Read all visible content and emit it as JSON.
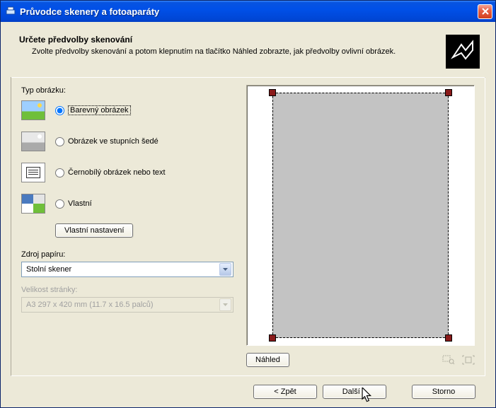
{
  "titlebar": {
    "title": "Průvodce skenery a fotoaparáty"
  },
  "header": {
    "title": "Určete předvolby skenování",
    "desc": "Zvolte předvolby skenování a potom klepnutím na tlačítko Náhled zobrazte, jak předvolby ovlivní obrázek."
  },
  "labels": {
    "picture_type": "Typ obrázku:",
    "paper_source": "Zdroj papíru:",
    "page_size": "Velikost stránky:"
  },
  "options": {
    "color": "Barevný obrázek",
    "grayscale": "Obrázek ve stupních šedé",
    "bw": "Černobílý obrázek nebo text",
    "custom": "Vlastní"
  },
  "buttons": {
    "custom_settings": "Vlastní nastavení",
    "preview": "Náhled",
    "back": "< Zpět",
    "next": "Další >",
    "cancel": "Storno"
  },
  "combos": {
    "paper_source_value": "Stolní skener",
    "page_size_value": "A3 297 x 420 mm (11.7 x 16.5 palců)"
  }
}
